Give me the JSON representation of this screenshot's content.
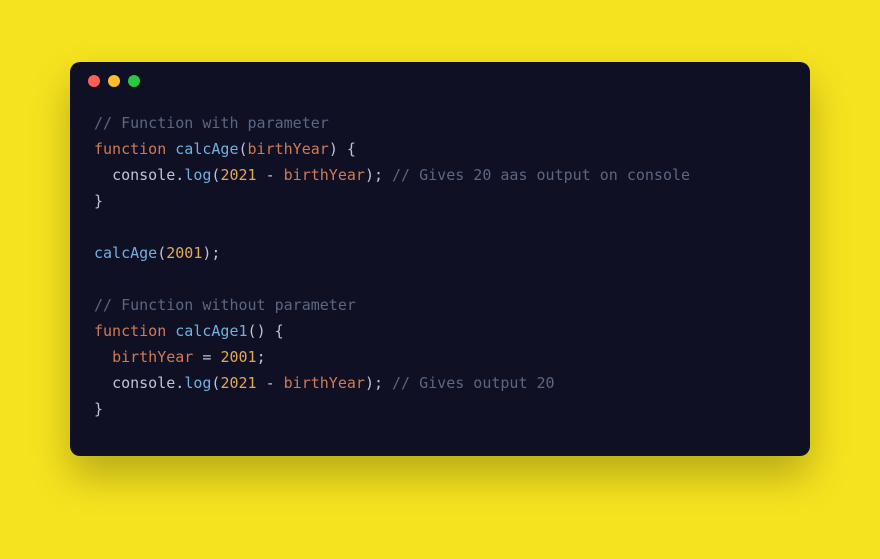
{
  "window": {
    "dots": {
      "red": "#ff5f56",
      "yellow": "#ffbd2e",
      "green": "#27c93f"
    }
  },
  "code": {
    "line1_comment": "// Function with parameter",
    "kw_function": "function",
    "fn_calcAge": "calcAge",
    "param_birthYear": "birthYear",
    "ident_console": "console",
    "method_log": "log",
    "num_2021": "2021",
    "op_minus": "-",
    "ident_birthYear": "birthYear",
    "line3_comment": "// Gives 20 aas output on console",
    "num_2001": "2001",
    "line7_comment": "// Function without parameter",
    "fn_calcAge1": "calcAge1",
    "assign_eq": "=",
    "line11_comment": "// Gives output 20",
    "p_open": "(",
    "p_close": ")",
    "b_open": "{",
    "b_close": "}",
    "semi": ";",
    "dot": "."
  }
}
